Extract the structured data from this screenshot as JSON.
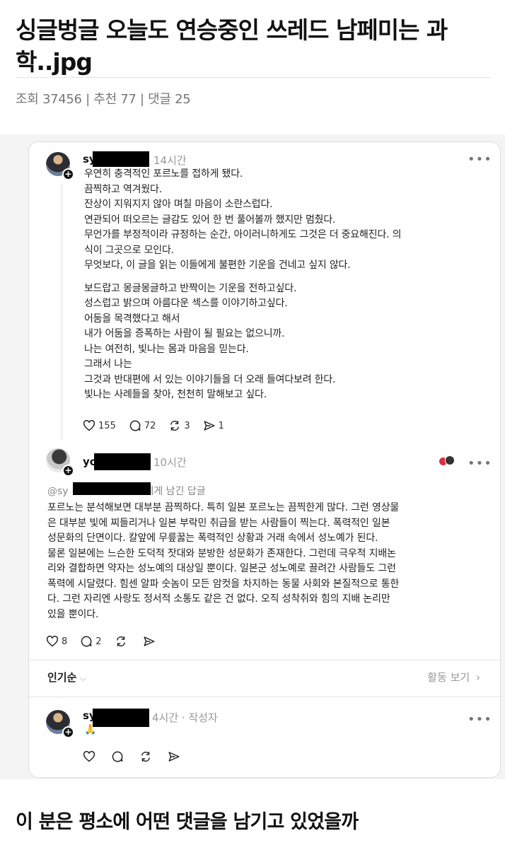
{
  "post": {
    "title": "싱글벙글 오늘도 연승중인 쓰레드 남페미는 과학..jpg",
    "meta": "조회 37456 | 추천 77 | 댓글 25",
    "caption": "이 분은 평소에 어떤 댓글을 남기고 있었을까"
  },
  "thread": {
    "main_post": {
      "username": "sy",
      "time": "14시간",
      "lines": [
        "우연히 충격적인 포르노를 접하게 됐다.",
        "끔찍하고 역겨웠다.",
        "잔상이 지워지지 않아 며칠 마음이 소란스럽다.",
        "연관되어 떠오르는 글감도 있어 한 번 풀어볼까 했지만 멈췄다.",
        "무언가를 부정적이라 규정하는 순간, 아이러니하게도 그것은 더 중요해진다. 의",
        "식이 그곳으로 모인다.",
        "무엇보다, 이 글을 읽는 이들에게 불편한 기운을 건네고 싶지 않다."
      ],
      "lines2": [
        "보드랍고 몽글몽글하고 반짝이는 기운을 전하고싶다.",
        "성스럽고 밝으며 아름다운 섹스를 이야기하고싶다.",
        "어둠을 목격했다고 해서",
        "내가 어둠을 증폭하는 사람이 될 필요는 없으니까.",
        "나는 여전히, 빛나는 몸과 마음을 믿는다.",
        "그래서 나는",
        "그것과 반대편에 서 있는 이야기들을 더 오래 들여다보려 한다.",
        "빛나는 사례들을 찾아, 천천히 말해보고 싶다."
      ],
      "likes": "155",
      "comments": "72",
      "reposts": "3",
      "shares": "1"
    },
    "reply": {
      "username": "yo",
      "time": "10시간",
      "reply_to_prefix": "@sy",
      "reply_to_suffix": "님에게 남긴 답글",
      "lines": [
        "포르노는 분석해보면 대부분 끔찍하다. 특히 일본 포르노는 끔찍한게 많다. 그런 영상물",
        "은 대부분 빛에 찌들리거나 일본 부락민 취급을 받는 사람들이 찍는다. 폭력적인 일본",
        "성문화의 단면이다. 칼앞에 무릎꿇는 폭력적인 상황과 거래 속에서 성노예가 된다.",
        "물론 일본에는 느슨한 도덕적 잣대와 분방한 성문화가 존재한다. 그런데 극우적 지배논",
        "리와 결합하면 약자는 성노예의 대상일 뿐이다. 일본군 성노예로 끌려간 사람들도 그런",
        "폭력에 시달렸다. 힘센 알파 숫놈이 모든 암컷을 차지하는 동물 사회와 본질적으로 통한",
        "다. 그런 자리엔 사랑도 정서적 소통도 같은 건 없다. 오직 성착취와 힘의 지배 논리만",
        "있을 뿐이다."
      ],
      "likes": "8",
      "comments": "2"
    },
    "sort_label": "인기순",
    "activity_label": "활동 보기",
    "author_reply": {
      "username": "sy",
      "time": "4시간 · 작성자",
      "emoji": "🙏"
    }
  }
}
